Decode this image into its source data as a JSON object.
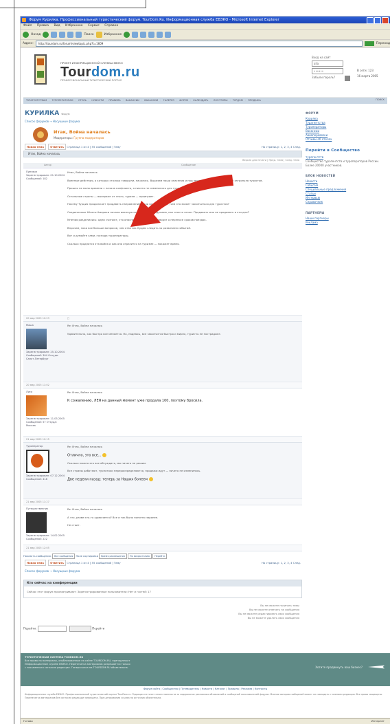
{
  "browser": {
    "window_title": "Форум Курилка. Профессиональный туристический форум. TourDom.Ru. Информационная служба ЕВЭКО - Microsoft Internet Explorer",
    "menu": [
      "Файл",
      "Правка",
      "Вид",
      "Избранное",
      "Сервис",
      "Справка"
    ],
    "back_label": "Назад",
    "search_label": "Поиск",
    "favorites_label": "Избранное",
    "address_label": "Адрес:",
    "address_url": "http://tourdom.ru/forum/viewtopic.php?t=1609",
    "go_label": "Переход",
    "status_left": "Готово",
    "status_right": "Интернет"
  },
  "site": {
    "tagline": "ПРОЕКТ ИНФОРМАЦИОННОЙ СЛУЖБЫ ЕВЭКО",
    "brand_left": "Tour",
    "brand_right": "dom.ru",
    "subtag": "ПРОФЕССИОНАЛЬНЫЙ ТУРИСТИЧЕСКИЙ ПОРТАЛ",
    "login": {
      "label": "Вход на сайт",
      "user_value": "alla",
      "pass_value": "••••••",
      "forgot": "Забыли пароль?",
      "online": "В сети: 123",
      "date": "16 марта 2005"
    },
    "nav": "ТУРАГЕНТСТВАМ · ТУРОПЕРАТОРАМ · ОТЕЛЬ · НОВОСТИ · ПРАВИЛА · ВАКАНСИИ · ВАКАНСИИ · ГАЛЕРЕЯ · ФОРУМ · КАЛЕНДАРЬ · ЛОГОТИПЫ · ТУРДОМ · ПРОДАЖА",
    "nav_search": "ПОИСК"
  },
  "forum": {
    "page_title": "КУРИЛКА",
    "page_title_small": "Форум",
    "breadcrumb": "Список форумов → Насущные форума",
    "topic_title": "Итак, Война началась",
    "moderators_label": "Модераторы:",
    "moderators": "Группа модераторов",
    "new_topic_btn": "Новая тема",
    "reply_btn": "Ответить",
    "pager_info": "Страница 1 из 4 [ 55 сообщений ] Тему",
    "pager_right": "На страницу: 1, 2, 3, 4   След.",
    "table_head": "Итак, Война началась",
    "col_author": "Автор",
    "col_message": "Сообщение",
    "view_options": "Версия для печати | Пред. тема | След. тема",
    "posts": [
      {
        "author": "Пингвин",
        "meta": "Зарегистрирован: 01.10.2004 Сообщений: 182",
        "lines": [
          "Итак, Война началась",
          "Военные действия, о которых столько говорили, начались. Выразим наши опасения и наш протест, чтобы эта война не затронула туристов.",
          "Прошло не мало времени с начала конфликта, а ничего не изменилось для туризма.",
          "Остальные страны — выиграют от этого, туризм — проиграет.",
          "Почему Турция продолжает продавать направление, если все понимают, чем это может закончиться для туристов?",
          "Соединенные Штаты Америки начали военную операцию, а мы думаем, как спасти сезон. Продавать или не продавать в эти дни?",
          "Мнения разделились: одни считают, что опасности нет, другие говорят о переносе сроков поездок.",
          "Впрочем, пока все больше вопросов, чем ответов. Будем следить за развитием событий.",
          "Вот и думайте сами, господа туроператоры.",
          "Сколько продлится эта война и как она отразится на туризме — покажет время."
        ],
        "date": "20 мар 2005 10:23"
      },
      {
        "author": "Маша",
        "meta": "Зарегистрирован: 25.10.2004 Сообщений: 304 Откуда: Санкт-Петербург",
        "lines": [
          "Re: Итак, Война началась",
          "Удивительно, как быстро все меняется. Но, надеюсь, все закончится быстро и мирно, туристы не пострадают."
        ],
        "date": "20 мар 2005 11:02"
      },
      {
        "author": "Лиса",
        "meta": "Зарегистрирован: 11.03.2005 Сообщений: 57 Откуда: Москва",
        "lines": [
          "Re: Итак, Война началась",
          "К сожалению, ЛЕЯ на данный момент уже продала 100, поэтому бросила."
        ],
        "date": "21 мар 2005 10:15"
      },
      {
        "author": "Туроператор",
        "meta": "Зарегистрирован: 07.12.2004 Сообщений: 418",
        "lines": [
          "Re: Итак, Война началась",
          "Отлично, это все...",
          "Сколько можно это все обсуждать, мы ничего не решим.",
          "Все страны работают, турпотоки перераспределяются, продажи идут — ничего не изменилось.",
          "Две недели назад: теперь за Наших болеем"
        ],
        "date": "21 мар 2005 11:27"
      },
      {
        "author": "Путешественник",
        "meta": "Зарегистрирован: 14.02.2005 Сообщений: 222",
        "lines": [
          "Re: Итак, Война началась",
          "А что, разве кто-то удивляется? Все и так было понятно заранее.",
          "Не стоит."
        ],
        "date": "21 мар 2005 12:05"
      }
    ],
    "bottom_bar": {
      "label": "Показать сообщения:",
      "sel1": "Все сообщения",
      "sel2": "Поле сортировки",
      "sel3": "Время размещения",
      "sel4": "По возрастанию",
      "go": "Перейти"
    },
    "who_title": "Кто сейчас на конференции",
    "who_body": "Сейчас этот форум просматривают: Зарегистрированные пользователи: Нет и гостей: 17",
    "legend": [
      "Вы не можете начинать темы",
      "Вы не можете отвечать на сообщения",
      "Вы не можете редактировать свои сообщения",
      "Вы не можете удалять свои сообщения"
    ],
    "jump_label": "Перейти:",
    "jump_go": "Перейти"
  },
  "sidebar": {
    "forums_h": "ФОРУМ",
    "forum_links": [
      "Курилка",
      "Турагентства",
      "Туроператоры",
      "Вакансии",
      "Авиаперевозки",
      "Отзывы об отелях"
    ],
    "subscribe_h": "Перейти в Сообщество",
    "subscribe_link": "турагентств",
    "subscribe_text": "Сообщество турагентств и туроператоров России. Более 20000 участников.",
    "news_h": "БЛОК НОВОСТЕЙ",
    "news_links": [
      "Новости",
      "События",
      "Специальные предложения",
      "Статьи",
      "Интервью",
      "Справочник"
    ],
    "partners_h": "ПАРТНЕРЫ",
    "partner_links": [
      "Наши партнеры",
      "Реклама"
    ]
  },
  "footer": {
    "band_lines": [
      "ТУРИСТИЧЕСКАЯ СИСТЕМА TOURDOM.RU",
      "Все права на материалы, опубликованные на сайте TOURDOM.RU, принадлежат",
      "Информационной службе ЕВЭКО. Перепечатка материалов разрешается только",
      "с письменного согласия редакции. Гиперссылка на TOURDOM.RU обязательна."
    ],
    "band_right": "Хотите продвинуть ваш бизнес?",
    "links": "Форум сайта | Сообщество | Путеводитель | Новости | Каталог | Правила | Реклама | Контакты",
    "legal": "Информационная служба ЕВЭКО. Профессиональный туристический портал TourDom.ru. Редакция не несет ответственности за содержание рекламных объявлений и сообщений пользователей форума. Мнение авторов сообщений может не совпадать с мнением редакции. Все права защищены. Перепечатка материалов без согласия редакции запрещена. При цитировании ссылка на источник обязательна."
  }
}
